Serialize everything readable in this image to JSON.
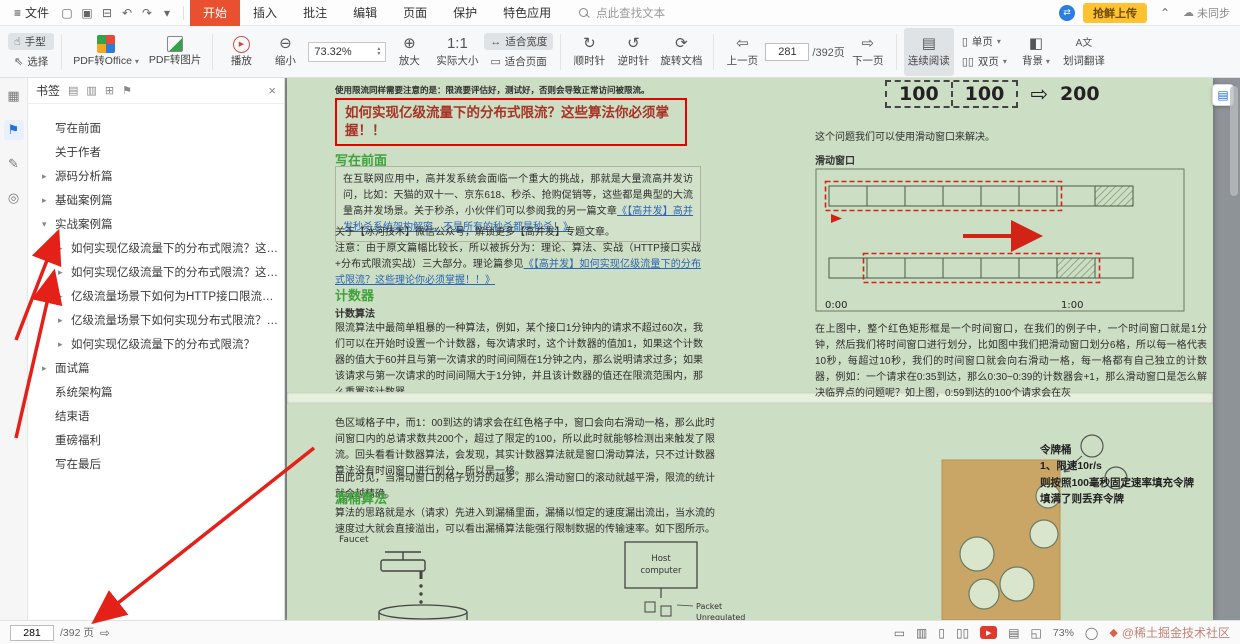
{
  "colors": {
    "accent_orange": "#e8502f",
    "upload_yellow": "#ffc233",
    "page_green": "#ccdec3",
    "heading_green": "#3fa23c",
    "link_blue": "#2d64b3",
    "annotation_red": "#e32119",
    "title_box_red": "#e60000",
    "bucket_tan": "#c9a566",
    "float_blue": "#1e6fe8"
  },
  "menubar": {
    "file_label": "文件",
    "tabs": [
      {
        "label": "开始"
      },
      {
        "label": "插入"
      },
      {
        "label": "批注"
      },
      {
        "label": "编辑"
      },
      {
        "label": "页面"
      },
      {
        "label": "保护"
      },
      {
        "label": "特色应用"
      }
    ],
    "search_label": "点此查找文本",
    "upload_label": "抢鲜上传",
    "sync_label": "未同步"
  },
  "toolbar": {
    "hand": "手型",
    "select": "选择",
    "pdf_to_office": "PDF转Office",
    "pdf_to_image": "PDF转图片",
    "play": "播放",
    "zoom_out": "缩小",
    "zoom_value": "73.32%",
    "zoom_in": "放大",
    "actual_size": "实际大小",
    "fit_width": "适合宽度",
    "fit_page": "适合页面",
    "clockwise": "顺时针",
    "counter_clockwise": "逆时针",
    "rotate_doc": "旋转文档",
    "prev_page": "上一页",
    "page_current": "281",
    "page_total": "/392页",
    "next_page": "下一页",
    "continuous": "连续阅读",
    "single_page": "单页",
    "double_page": "双页",
    "background": "背景",
    "translate": "划词翻译"
  },
  "sidebar": {
    "title": "书签",
    "items": [
      {
        "label": "写在前面",
        "arrow": ""
      },
      {
        "label": "关于作者",
        "arrow": ""
      },
      {
        "label": "源码分析篇",
        "arrow": "▸"
      },
      {
        "label": "基础案例篇",
        "arrow": "▸"
      },
      {
        "label": "实战案例篇",
        "arrow": "▾"
      },
      {
        "label": "如何实现亿级流量下的分布式限流？这些理论你...",
        "arrow": "▸"
      },
      {
        "label": "如何实现亿级流量下的分布式限流？这些算法...",
        "arrow": "▸"
      },
      {
        "label": "亿级流量场景下如何为HTTP接口限流？看完我...",
        "arrow": "▸"
      },
      {
        "label": "亿级流量场景下如何实现分布式限流？看完彻...",
        "arrow": "▸"
      },
      {
        "label": "如何实现亿级流量下的分布式限流？",
        "arrow": "▸"
      },
      {
        "label": "面试篇",
        "arrow": "▸"
      },
      {
        "label": "系统架构篇",
        "arrow": ""
      },
      {
        "label": "结束语",
        "arrow": ""
      },
      {
        "label": "重磅福利",
        "arrow": ""
      },
      {
        "label": "写在最后",
        "arrow": ""
      }
    ]
  },
  "document": {
    "note_top": "使用限流同样需要注意的是：限流要评估好，测试好，否则会导致正常访问被限流。",
    "title": "如何实现亿级流量下的分布式限流？这些算法你必须掌握！！",
    "h_foreword": "写在前面",
    "p_intro": "在互联网应用中，高并发系统会面临一个重大的挑战，那就是大量流高并发访问，比如：天猫的双十一、京东618、秒杀、抢购促销等，这些都是典型的大流量高并发场景。关于秒杀，小伙伴们可以参阅我的另一篇文章",
    "p_intro_link": "《【高并发】高并发秒杀系统架构解密，不是所有的秒杀都是秒杀！》",
    "p_about": "关于【冰河技术】微信公众号，解锁更多【高并发】专题文章。",
    "p_note": "注意：由于原文篇幅比较长，所以被拆分为：理论、算法、实战（HTTP接口实战+分布式限流实战）三大部分。理论篇参见",
    "p_note_link": "《【高并发】如何实现亿级流量下的分布式限流？这些理论你必须掌握！！》",
    "h_counter": "计数器",
    "h_counter_sub": "计数算法",
    "p_counter": "限流算法中最简单粗暴的一种算法，例如，某个接口1分钟内的请求不超过60次，我们可以在开始时设置一个计数器，每次请求时，这个计数器的值加1，如果这个计数器的值大于60并且与第一次请求的时间间隔在1分钟之内，那么说明请求过多；如果该请求与第一次请求的时间间隔大于1分钟，并且该计数器的值还在限流范围内，那么重置该计数器。",
    "p_window": "色区域格子中，而1：00到达的请求会在红色格子中，窗口会向右滑动一格，那么此时间窗口内的总请求数共200个，超过了限定的100，所以此时就能够检测出来触发了限流。回头看看计数器算法，会发现，其实计数器算法就是窗口滑动算法，只不过计数器算法没有时间窗口进行划分，所以是一格。",
    "p_window2": "由此可见，当滑动窗口的格子划分的越多，那么滑动窗口的滚动就越平滑，限流的统计就会越精确。",
    "h_leaky": "漏桶算法",
    "p_leaky": "算法的思路就是水（请求）先进入到漏桶里面，漏桶以恒定的速度漏出流出，当水流的速度过大就会直接溢出，可以看出漏桶算法能强行限制数据的传输速率。如下图所示。",
    "r_intro": "这个问题我们可以使用滑动窗口来解决。",
    "r_window_label": "滑动窗口",
    "r_p": "在上图中，整个红色矩形框是一个时间窗口，在我们的例子中，一个时间窗口就是1分钟，然后我们将时间窗口进行划分，比如图中我们把滑动窗口划分6格，所以每一格代表10秒，每超过10秒，我们的时间窗口就会向右滑动一格，每一格都有自己独立的计数器，例如：一个请求在0:35到达，那么0:30~0:39的计数器会+1，那么滑动窗口是怎么解决临界点的问题呢？如上图，0:59到达的100个请求会在灰",
    "token_title": "令牌桶",
    "token_l1": "1、限速10r/s",
    "token_l2": "则按照100毫秒固定速率填充令牌",
    "token_l3": "填满了则丢弃令牌",
    "num1": "100",
    "num2": "100",
    "num3": "200",
    "t_start": "0:00",
    "t_end": "1:00",
    "faucet_label": "Faucet",
    "host_label1": "Host",
    "host_label2": "computer",
    "packet_label": "Packet",
    "unregulated_label": "Unregulated"
  },
  "statusbar": {
    "page_current": "281",
    "page_total": "/392 页",
    "zoom": "73%",
    "watermark": "@稀土掘金技术社区"
  },
  "icons": {
    "hamburger": "≡",
    "open_doc": "▢",
    "save_doc": "▣",
    "print_doc": "⊟",
    "undo": "↶",
    "redo": "↷",
    "caret_down": "▾",
    "caret_up": "▴",
    "sync_arrows": "⇄",
    "collapse": "⌃",
    "cloud": "☁",
    "hand": "☝",
    "cursor": "⇖",
    "play": "▶",
    "zoom_out": "⊖",
    "zoom_in": "⊕",
    "actual_size": "1:1",
    "fit_width": "↔",
    "fit_page": "▭",
    "clockwise": "↻",
    "counter_clockwise": "↺",
    "rotate_doc": "⟳",
    "prev": "⇦",
    "next": "⇨",
    "continuous": "▤",
    "single": "▯",
    "double": "▯▯",
    "background": "◧",
    "translate": "A文",
    "thumbnails": "▦",
    "bookmark_flag": "⚑",
    "pen": "✎",
    "attach": "◎",
    "outline1": "▤",
    "outline2": "▥",
    "add": "⊞",
    "close": "×",
    "projector": "▭",
    "pages": "▥",
    "book": "▤",
    "fullscreen": "◱",
    "circle": "◯",
    "diamond": "◆",
    "arrow_jump": "⇨"
  }
}
